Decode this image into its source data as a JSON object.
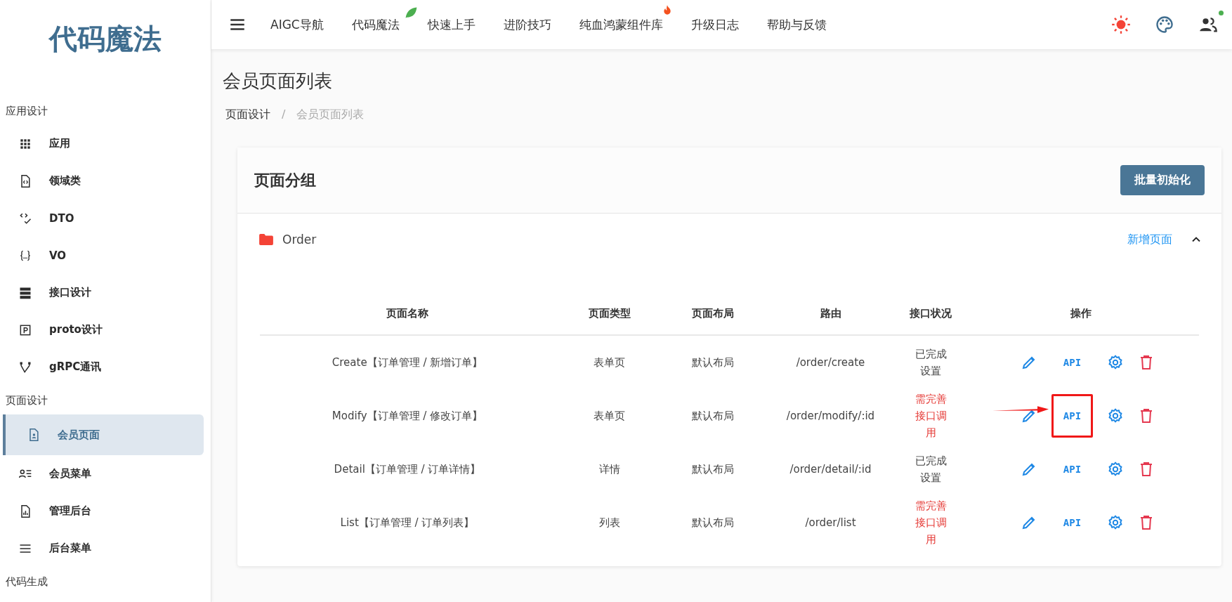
{
  "logo": "代码魔法",
  "sidebar": {
    "sections": [
      {
        "label": "应用设计",
        "items": [
          {
            "label": "应用",
            "selected": false
          },
          {
            "label": "领域类",
            "selected": false
          },
          {
            "label": "DTO",
            "selected": false
          },
          {
            "label": "VO",
            "selected": false
          },
          {
            "label": "接口设计",
            "selected": false
          },
          {
            "label": "proto设计",
            "selected": false
          },
          {
            "label": "gRPC通讯",
            "selected": false
          }
        ]
      },
      {
        "label": "页面设计",
        "items": [
          {
            "label": "会员页面",
            "selected": true
          },
          {
            "label": "会员菜单",
            "selected": false
          },
          {
            "label": "管理后台",
            "selected": false
          },
          {
            "label": "后台菜单",
            "selected": false
          }
        ]
      },
      {
        "label": "代码生成"
      }
    ]
  },
  "nav": [
    {
      "label": "AIGC导航",
      "kind": "plain"
    },
    {
      "label": "代码魔法",
      "kind": "leaf"
    },
    {
      "label": "快速上手",
      "kind": "plain"
    },
    {
      "label": "进阶技巧",
      "kind": "plain"
    },
    {
      "label": "纯血鸿蒙组件库",
      "kind": "fire"
    },
    {
      "label": "升级日志",
      "kind": "plain"
    },
    {
      "label": "帮助与反馈",
      "kind": "plain"
    }
  ],
  "user_online": true,
  "page_title": "会员页面列表",
  "breadcrumb": {
    "items": [
      "页面设计",
      "会员页面列表"
    ],
    "separator": "/"
  },
  "card": {
    "title": "页面分组",
    "button": "批量初始化",
    "group": {
      "name": "Order",
      "add_link": "新增页面",
      "expanded": true
    },
    "columns": [
      "页面名称",
      "页面类型",
      "页面布局",
      "路由",
      "接口状况",
      "操作"
    ],
    "rows": [
      {
        "name": "Create【订单管理 / 新增订单】",
        "type": "表单页",
        "layout": "默认布局",
        "route": "/order/create",
        "status": "已完成设置",
        "complete": true,
        "api": "API",
        "highlighted": false
      },
      {
        "name": "Modify【订单管理 / 修改订单】",
        "type": "表单页",
        "layout": "默认布局",
        "route": "/order/modify/:id",
        "status": "需完善接口调用",
        "complete": false,
        "api": "API",
        "highlighted": true
      },
      {
        "name": "Detail【订单管理 / 订单详情】",
        "type": "详情",
        "layout": "默认布局",
        "route": "/order/detail/:id",
        "status": "已完成设置",
        "complete": true,
        "api": "API",
        "highlighted": false
      },
      {
        "name": "List【订单管理 / 订单列表】",
        "type": "列表",
        "layout": "默认布局",
        "route": "/order/list",
        "status": "需完善接口调用",
        "complete": false,
        "api": "API",
        "highlighted": false
      }
    ]
  }
}
